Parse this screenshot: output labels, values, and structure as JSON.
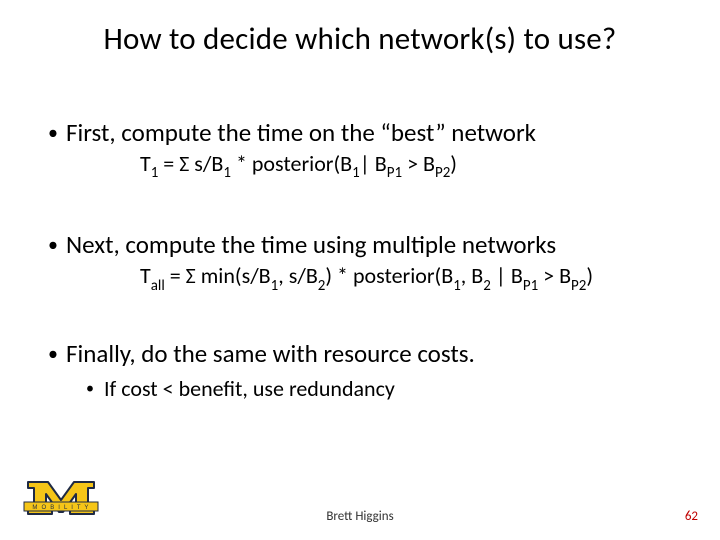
{
  "title": "How to decide which network(s) to use?",
  "bullets": {
    "b1": "First, compute the time on the “best” network",
    "b2": "Next, compute the time using multiple networks",
    "b3": "Finally, do the same with resource costs.",
    "sub1": "If cost < benefit, use redundancy"
  },
  "formulas": {
    "f1": {
      "lhs_base": "T",
      "lhs_sub": "1",
      "rhs_pre": " = Σ s/B",
      "rhs_b1sub": "1",
      "rhs_mid": " * posterior(B",
      "rhs_pb1sub": "1",
      "rhs_bar": "| B",
      "rhs_bp1sub": "P1",
      "rhs_gt": " > B",
      "rhs_bp2sub": "P2",
      "rhs_end": ")"
    },
    "f2": {
      "lhs_base": "T",
      "lhs_sub": "all",
      "rhs_pre": " = Σ min(s/B",
      "rhs_m1sub": "1",
      "rhs_comma1": ", s/B",
      "rhs_m2sub": "2",
      "rhs_close_post": ") * posterior(B",
      "rhs_pb1sub": "1",
      "rhs_comma2": ", B",
      "rhs_pb2sub": "2",
      "rhs_bar": " | B",
      "rhs_bp1sub": "P1",
      "rhs_gt": " > B",
      "rhs_bp2sub": "P2",
      "rhs_end": ")"
    }
  },
  "footer": {
    "author": "Brett Higgins",
    "page": "62"
  },
  "logo": {
    "banner_text": "M O B I L I T Y",
    "colors": {
      "maize": "#f5c518",
      "blue": "#1f2a44"
    }
  }
}
